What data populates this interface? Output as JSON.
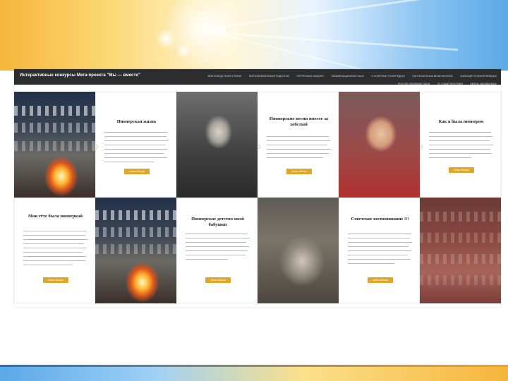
{
  "site": {
    "title": "Интерактивные конкурсы Мега-проекта \"Мы — вместе\"",
    "nav": [
      "ВОЙ ПОБЕДУ ВСЕЙ СТРАНЕ",
      "ВЫЙ МИНИМАЛЬНЫЙ ПОДГОТОВ",
      "ПОРТФОЛИО ОБЩЕНИ",
      "ЭКЗАМЕНАЦИОННАЯ ЗАЛА",
      "О ПОЛЕЗНЫХ ПОПЕРЕДКАХ",
      "ПАНТЕОНИЧНЫЕ ВЕЛИЧНИЧНЫЕ",
      "МАМАНДЕТИ ЕКАТЕРИНИЦЫХ",
      "РОССИИ ЛЮБИМЫЕ ОДНИ",
      "ГО СЛАВОТЕНСТВИЯ",
      "ИМЕНА ЗАБИВАЕМЫХ"
    ]
  },
  "cards": [
    {
      "title": "Пионерская жизнь",
      "button": "Узнать больше"
    },
    {
      "title": "Пионерские песни вместе за хобелый",
      "button": "Узнать больше"
    },
    {
      "title": "Как я была пионером",
      "button": "Узнать больше"
    },
    {
      "title": "Мои тёте была пионеркой",
      "button": "Узнать больше"
    },
    {
      "title": "Пионерское детство моей бабушки",
      "button": "Узнать больше"
    },
    {
      "title": "Советское воспоминание !!!",
      "button": "Узнать больше"
    }
  ],
  "photos": [
    {
      "name": "campfire-photo",
      "caption": ""
    },
    {
      "name": "pioneer-girl-bw-photo",
      "caption": ""
    },
    {
      "name": "child-pioneer-color-photo",
      "caption": ""
    },
    {
      "name": "campfire-photo-2",
      "caption": ""
    },
    {
      "name": "three-women-photo",
      "caption": ""
    },
    {
      "name": "class-group-photo",
      "caption": ""
    }
  ],
  "colors": {
    "header_bg": "#2b2d2f",
    "button_accent": "#e0a62a",
    "slide_top_warm": "#f6b53a",
    "slide_top_cool": "#5aa9e8"
  }
}
